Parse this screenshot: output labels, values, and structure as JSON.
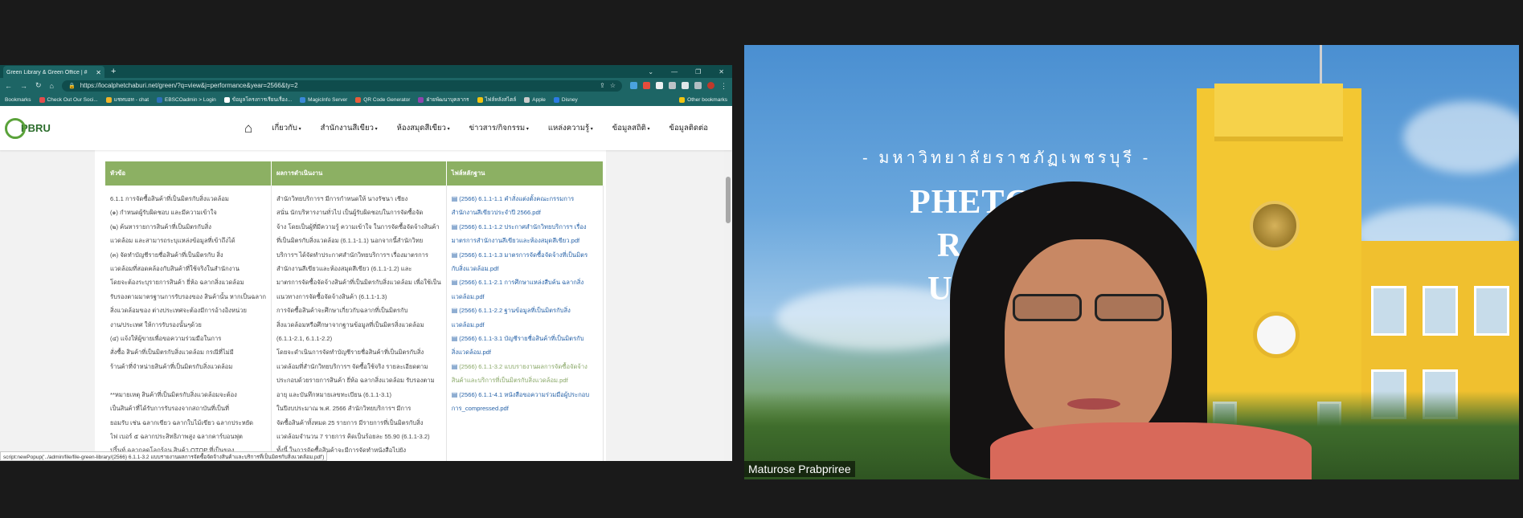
{
  "browser": {
    "tab_title": "Green Library & Green Office | #",
    "url": "https://localphetchaburi.net/green/?q=view&j=performance&year=2566&ty=2",
    "bookmarks": [
      {
        "label": "Bookmarks",
        "color": ""
      },
      {
        "label": "Check Out Our Soci...",
        "color": "#e34c4c"
      },
      {
        "label": "แชทบอท - chat",
        "color": "#f0b429"
      },
      {
        "label": "EBSCOadmin > Login",
        "color": "#2c6fb8"
      },
      {
        "label": "ข้อมูลโครงการเรียนเรื่อง...",
        "color": "#ffffff"
      },
      {
        "label": "MagicInfo Server",
        "color": "#3a88d8"
      },
      {
        "label": "QR Code Generator",
        "color": "#e85c3a"
      },
      {
        "label": "ฝ่ายพัฒนาบุคลากร",
        "color": "#8e44ad"
      },
      {
        "label": "ไฟล์หลังสไตล์",
        "color": "#f1c40f"
      },
      {
        "label": "Apple",
        "color": "#cccccc"
      },
      {
        "label": "Disney",
        "color": "#2c7be5"
      }
    ],
    "other_bookmarks": "Other bookmarks",
    "status_url": "script:newPopup('../admin/file/file-green-library/(2566) 6.1.1-3.2 แบบรายงานผลการจัดซื้อจัดจ้างสินค้าและบริการที่เป็นมิตรกับสิ่งแวดล้อม.pdf')"
  },
  "site": {
    "logo_text": "PBRU",
    "menu": {
      "about": "เกี่ยวกับ",
      "green_office": "สำนักงานสีเขียว",
      "green_library": "ห้องสมุดสีเขียว",
      "news": "ข่าวสาร/กิจกรรม",
      "sources": "แหล่งความรู้",
      "stats": "ข้อมูลสถิติ",
      "contact": "ข้อมูลติดต่อ"
    },
    "table": {
      "headers": [
        "หัวข้อ",
        "ผลการดำเนินงาน",
        "ไฟล์หลักฐาน"
      ],
      "col1_lines": [
        "6.1.1 การจัดซื้อสินค้าที่เป็นมิตรกับสิ่งแวดล้อม",
        "(๑) กำหนดผู้รับผิดชอบ และมีความเข้าใจ",
        "(๒) ค้นหารายการสินค้าที่เป็นมิตรกับสิ่ง",
        "แวดล้อม และสามารถระบุแหล่งข้อมูลที่เข้าถึงได้",
        "(๓) จัดทำบัญชีรายชื่อสินค้าที่เป็นมิตรกับ สิ่ง",
        "แวดล้อมที่สอดคล้องกับสินค้าที่ใช้จริงในสำนักงาน",
        "โดยจะต้องระบุรายการสินค้า ยี่ห้อ ฉลากสิ่งแวดล้อม",
        "รับรองตามมาตรฐานการรับรองของ สินค้านั้น หากเป็นฉลาก",
        "สิ่งแวดล้อมของ ต่างประเทศจะต้องมีการอ้างอิงหน่วย",
        "งาน/ประเทศ ให้การรับรองนั้นๆด้วย",
        "(๔) แจ้งให้ผู้ขายเพื่อขอความร่วมมือในการ",
        "สั่งซื้อ สินค้าที่เป็นมิตรกับสิ่งแวดล้อม กรณีที่ไม่มี",
        "ร้านค้าที่จำหน่ายสินค้าที่เป็นมิตรกับสิ่งแวดล้อม",
        "",
        "**หมายเหตุ สินค้าที่เป็นมิตรกับสิ่งแวดล้อมจะต้อง",
        "เป็นสินค้าที่ได้รับการรับรองจากสถาบันที่เป็นที่",
        "ยอมรับ เช่น ฉลากเขียว ฉลากใบไม้เขียว ฉลากประหยัด",
        "ไฟ เบอร์ ๕ ฉลากประสิทธิภาพสูง ฉลากคาร์บอนฟุต",
        "ปริ้นท์ ฉลากลดโลกร้อน สินค้า OTOP ที่เป็นของ"
      ],
      "col2_lines": [
        "สำนักวิทยบริการฯ มีการกำหนดให้ นางรัชนา เชียง",
        "สนั่น นักบริหารงานทั่วไป เป็นผู้รับผิดชอบในการจัดซื้อจัด",
        "จ้าง โดยเป็นผู้ที่มีความรู้ ความเข้าใจ ในการจัดซื้อจัดจ้างสินค้า",
        "ที่เป็นมิตรกับสิ่งแวดล้อม (6.1.1-1.1) นอกจากนี้สำนักวิทย",
        "บริการฯ ได้จัดทำประกาศสำนักวิทยบริการฯ เรื่องมาตรการ",
        "สำนักงานสีเขียวและห้องสมุดสีเขียว (6.1.1-1.2) และ",
        "มาตรการจัดซื้อจัดจ้างสินค้าที่เป็นมิตรกับสิ่งแวดล้อม เพื่อใช้เป็น",
        "แนวทางการจัดซื้อจัดจ้างสินค้า (6.1.1-1.3)",
        "การจัดซื้อสินค้าจะศึกษาเกี่ยวกับฉลากที่เป็นมิตรกับ",
        "สิ่งแวดล้อมหรือศึกษาจากฐานข้อมูลที่เป็นมิตรสิ่งแวดล้อม",
        "(6.1.1-2.1, 6.1.1-2.2)",
        "โดยจะดำเนินการจัดทำบัญชีรายชื่อสินค้าที่เป็นมิตรกับสิ่ง",
        "แวดล้อมที่สำนักวิทยบริการฯ จัดซื้อใช้จริง รายละเอียดตาม",
        "ประกอบด้วยรายการสินค้า ยี่ห้อ ฉลากสิ่งแวดล้อม รับรองตาม",
        "อายุ และบันทึกหมายเลขทะเบียน (6.1.1-3.1)",
        "ในปีงบประมาณ พ.ศ. 2566 สำนักวิทยบริการฯ มีการ",
        "จัดซื้อสินค้าทั้งหมด 25 รายการ มีรายการที่เป็นมิตรกับสิ่ง",
        "แวดล้อมจำนวน 7 รายการ คิดเป็นร้อยละ 55.90 (6.1.1-3.2)",
        "ทั้งนี้ ในการจัดซื้อสินค้าจะมีการจัดทำหนังสือไปยัง"
      ],
      "files": [
        "(2566) 6.1.1-1.1 คำสั่งแต่งตั้งคณะกรรมการ",
        "สำนักงานสีเขียวประจำปี 2566.pdf",
        "(2566) 6.1.1-1.2 ประกาศสำนักวิทยบริการฯ เรื่อง",
        "มาตรการสำนักงานสีเขียวและห้องสมุดสีเขียว.pdf",
        "(2566) 6.1.1-1.3 มาตรการจัดซื้อจัดจ้างที่เป็นมิตร",
        "กับสิ่งแวดล้อม.pdf",
        "(2566) 6.1.1-2.1 การศึกษาแหล่งสืบค้น ฉลากสิ่ง",
        "แวดล้อม.pdf",
        "(2566) 6.1.1-2.2 ฐานข้อมูลที่เป็นมิตรกับสิ่ง",
        "แวดล้อม.pdf",
        "(2566) 6.1.1-3.1 บัญชีรายชื่อสินค้าที่เป็นมิตรกับ",
        "สิ่งแวดล้อม.pdf",
        "(2566) 6.1.1-3.2 แบบรายงานผลการจัดซื้อจัดจ้าง",
        "สินค้าและบริการที่เป็นมิตรกับสิ่งแวดล้อม.pdf",
        "(2566) 6.1.1-4.1 หนังสือขอความร่วมมือผู้ประกอบ",
        "การ_compressed.pdf"
      ]
    }
  },
  "video": {
    "banner_th": "- มหาวิทยาลัยราชภัฏเพชรบุรี -",
    "banner_en_lines": [
      "PHETCHAB",
      "RAJA",
      "UNI"
    ],
    "participant_name": "Maturose Prabpriree"
  }
}
